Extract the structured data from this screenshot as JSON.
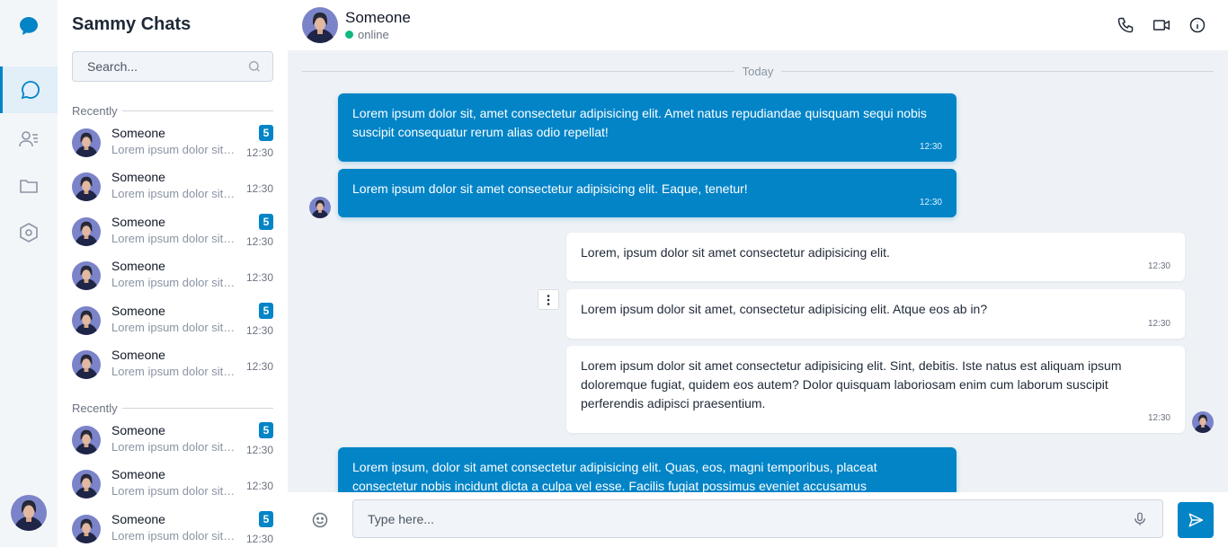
{
  "app": {
    "title": "Sammy Chats",
    "accent": "#0284c7"
  },
  "rail": {
    "items": [
      {
        "icon": "chat-bubble-icon",
        "active": true
      },
      {
        "icon": "contacts-icon",
        "active": false
      },
      {
        "icon": "folder-icon",
        "active": false
      },
      {
        "icon": "settings-hexagon-icon",
        "active": false
      }
    ]
  },
  "search": {
    "placeholder": "Search..."
  },
  "sections": [
    {
      "label": "Recently"
    },
    {
      "label": "Recently"
    }
  ],
  "chats": [
    {
      "name": "Someone",
      "preview": "Lorem ipsum dolor sit amet consectetur",
      "time": "12:30",
      "badge": "5"
    },
    {
      "name": "Someone",
      "preview": "Lorem ipsum dolor sit amet consectetur",
      "time": "12:30",
      "badge": ""
    },
    {
      "name": "Someone",
      "preview": "Lorem ipsum dolor sit amet consectetur",
      "time": "12:30",
      "badge": "5"
    },
    {
      "name": "Someone",
      "preview": "Lorem ipsum dolor sit amet consectetur",
      "time": "12:30",
      "badge": ""
    },
    {
      "name": "Someone",
      "preview": "Lorem ipsum dolor sit amet consectetur",
      "time": "12:30",
      "badge": "5"
    },
    {
      "name": "Someone",
      "preview": "Lorem ipsum dolor sit amet consectetur",
      "time": "12:30",
      "badge": ""
    },
    {
      "name": "Someone",
      "preview": "Lorem ipsum dolor sit amet consectetur",
      "time": "12:30",
      "badge": "5"
    },
    {
      "name": "Someone",
      "preview": "Lorem ipsum dolor sit amet consectetur",
      "time": "12:30",
      "badge": ""
    },
    {
      "name": "Someone",
      "preview": "Lorem ipsum dolor sit amet consectetur",
      "time": "12:30",
      "badge": "5"
    }
  ],
  "header": {
    "name": "Someone",
    "status": "online",
    "status_color": "#10b981"
  },
  "divider": {
    "label": "Today"
  },
  "messages": [
    {
      "direction": "incoming",
      "text": "Lorem ipsum dolor sit, amet consectetur adipisicing elit. Amet natus repudiandae quisquam sequi nobis suscipit consequatur rerum alias odio repellat!",
      "time": "12:30"
    },
    {
      "direction": "incoming",
      "text": "Lorem ipsum dolor sit amet consectetur adipisicing elit. Eaque, tenetur!",
      "time": "12:30"
    },
    {
      "direction": "outgoing",
      "text": "Lorem, ipsum dolor sit amet consectetur adipisicing elit.",
      "time": "12:30"
    },
    {
      "direction": "outgoing",
      "text": "Lorem ipsum dolor sit amet, consectetur adipisicing elit. Atque eos ab in?",
      "time": "12:30"
    },
    {
      "direction": "outgoing",
      "text": "Lorem ipsum dolor sit amet consectetur adipisicing elit. Sint, debitis. Iste natus est aliquam ipsum doloremque fugiat, quidem eos autem? Dolor quisquam laboriosam enim cum laborum suscipit perferendis adipisci praesentium.",
      "time": "12:30"
    },
    {
      "direction": "incoming",
      "text": "Lorem ipsum, dolor sit amet consectetur adipisicing elit. Quas, eos, magni temporibus, placeat consectetur nobis incidunt dicta a culpa vel esse. Facilis fugiat possimus eveniet accusamus",
      "time": ""
    }
  ],
  "composer": {
    "placeholder": "Type here..."
  }
}
